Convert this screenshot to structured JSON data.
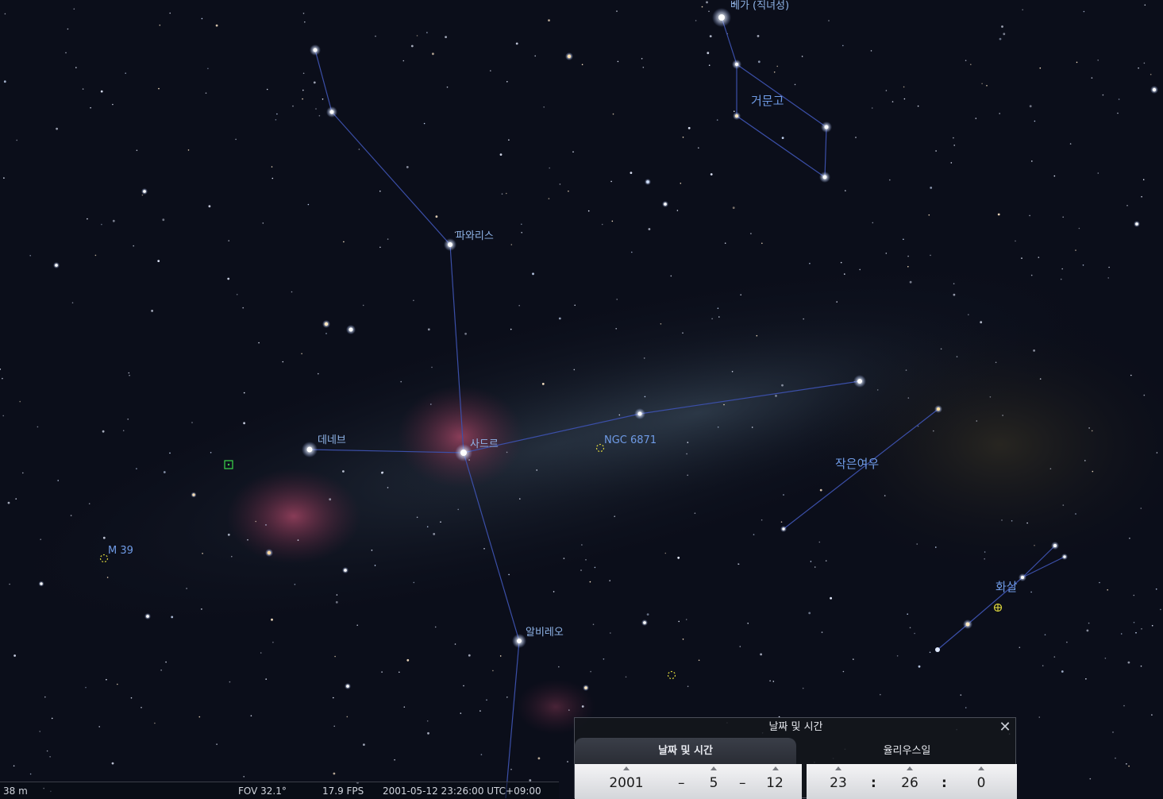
{
  "sky": {
    "star_labels": {
      "vega": "베가 (직녀성)",
      "fawaris": "파와리스",
      "deneb": "데네브",
      "sadr": "사드르",
      "albireo": "알비레오",
      "ngc6871": "NGC 6871",
      "m39": "M 39"
    },
    "constellations": {
      "lyra": "거문고",
      "vulpecula": "작은여우",
      "sagitta": "화살"
    }
  },
  "statusbar": {
    "altitude": "38 m",
    "fov": "FOV 32.1°",
    "fps": "17.9 FPS",
    "datetime": "2001-05-12 23:26:00 UTC+09:00"
  },
  "datetime_dialog": {
    "title": "날짜 및 시간",
    "close_symbol": "✕",
    "tabs": [
      "날짜 및 시간",
      "율리우스일"
    ],
    "date": {
      "year": "2001",
      "month": "5",
      "day": "12",
      "sep": "–"
    },
    "time": {
      "hour": "23",
      "minute": "26",
      "second": "0",
      "sep": ":"
    }
  },
  "colors": {
    "constellation_line": "#3b4fa8",
    "star_label": "#8fb4e8",
    "constellation_label": "#6f9be6",
    "dso_marker": "#d8d23c"
  }
}
